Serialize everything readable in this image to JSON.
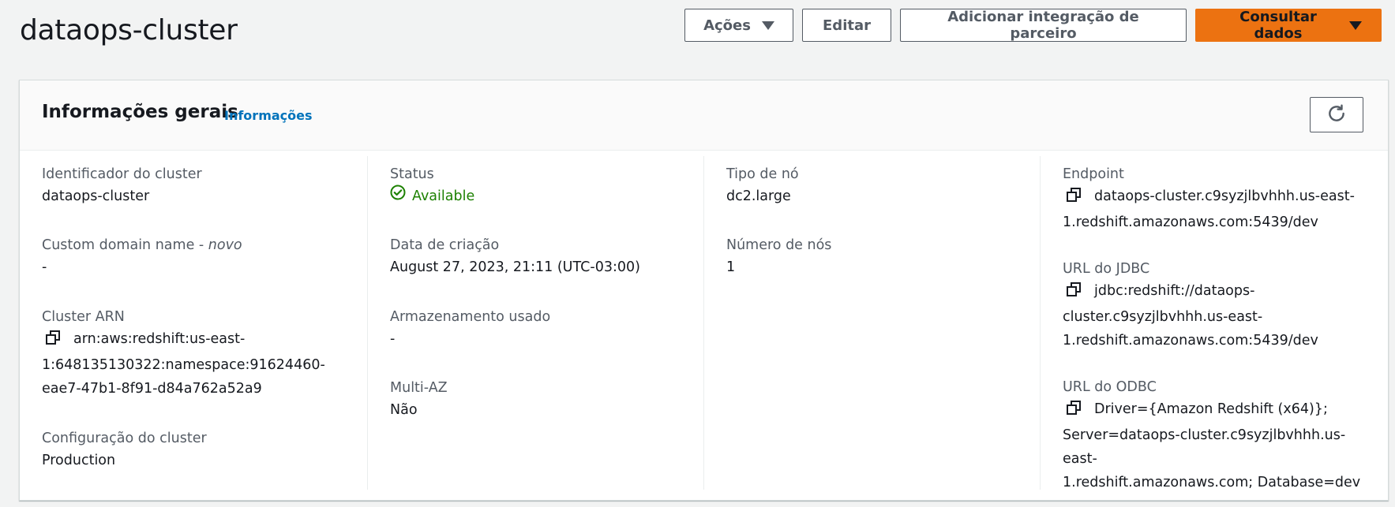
{
  "page": {
    "title": "dataops-cluster"
  },
  "actions": {
    "acoes_label": "Ações",
    "editar_label": "Editar",
    "adicionar_label": "Adicionar integração de parceiro",
    "consultar_label": "Consultar dados"
  },
  "panel": {
    "title": "Informações gerais",
    "info_link": "Informações"
  },
  "col1": {
    "cluster_id_label": "Identificador do cluster",
    "cluster_id_value": "dataops-cluster",
    "custom_domain_label": "Custom domain name - ",
    "custom_domain_tag": "novo",
    "custom_domain_value": "-",
    "arn_label": "Cluster ARN",
    "arn_value_line1": "arn:aws:redshift:us-east-",
    "arn_value_line2": "1:648135130322:namespace:91624460-",
    "arn_value_line3": "eae7-47b1-8f91-d84a762a52a9",
    "config_label": "Configuração do cluster",
    "config_value": "Production"
  },
  "col2": {
    "status_label": "Status",
    "status_value": "Available",
    "created_label": "Data de criação",
    "created_value": "August 27, 2023, 21:11 (UTC-03:00)",
    "storage_label": "Armazenamento usado",
    "storage_value": "-",
    "multiaz_label": "Multi-AZ",
    "multiaz_value": "Não"
  },
  "col3": {
    "node_type_label": "Tipo de nó",
    "node_type_value": "dc2.large",
    "node_count_label": "Número de nós",
    "node_count_value": "1"
  },
  "col4": {
    "endpoint_label": "Endpoint",
    "endpoint_line1": "dataops-cluster.c9syzjlbvhhh.us-east-",
    "endpoint_line2": "1.redshift.amazonaws.com:5439/dev",
    "jdbc_label": "URL do JDBC",
    "jdbc_line1": "jdbc:redshift://dataops-",
    "jdbc_line2": "cluster.c9syzjlbvhhh.us-east-",
    "jdbc_line3": "1.redshift.amazonaws.com:5439/dev",
    "odbc_label": "URL do ODBC",
    "odbc_line1": "Driver={Amazon Redshift (x64)};",
    "odbc_line2": "Server=dataops-cluster.c9syzjlbvhhh.us-east-",
    "odbc_line3": "1.redshift.amazonaws.com; Database=dev"
  },
  "colors": {
    "primary": "#ec7211",
    "link": "#0073bb",
    "success": "#1d8102"
  },
  "icons": [
    "caret-down-icon",
    "refresh-icon",
    "copy-icon",
    "status-available-icon"
  ]
}
